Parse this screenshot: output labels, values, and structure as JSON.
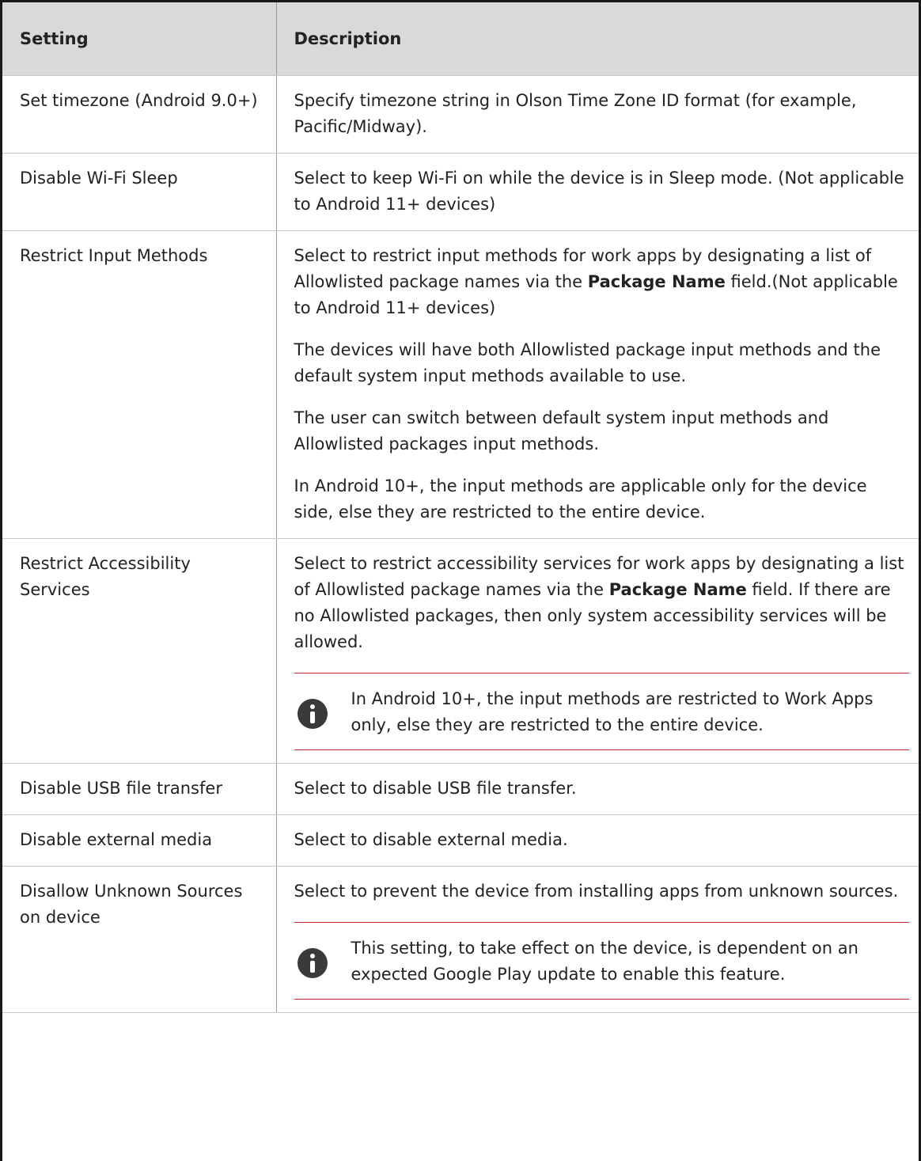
{
  "table": {
    "headers": [
      "Setting",
      "Description"
    ],
    "rows": [
      {
        "setting": "Set timezone (Android 9.0+)",
        "paragraphs": [
          [
            "Specify timezone string in Olson Time Zone ID format (for example, Pacific/Midway)."
          ]
        ]
      },
      {
        "setting": "Disable Wi-Fi Sleep",
        "paragraphs": [
          [
            "Select to keep Wi-Fi on while the device is in Sleep mode. (Not applicable to Android 11+ devices)"
          ]
        ]
      },
      {
        "setting": "Restrict Input Methods",
        "paragraphs": [
          [
            "Select to restrict input methods for work apps by designating a list of Allowlisted package names via the ",
            "Package Name",
            " field.(Not applicable to Android 11+ devices)"
          ],
          [
            "The devices will have both Allowlisted package input methods and the default system input methods available to use."
          ],
          [
            "The user can switch between default system input methods and Allowlisted packages input methods."
          ],
          [
            "In Android 10+, the input methods are applicable only for the device side, else they are restricted to the entire device."
          ]
        ]
      },
      {
        "setting": "Restrict Accessibility Services",
        "paragraphs": [
          [
            "Select to restrict accessibility services for work apps by designating a list of Allowlisted package names via the ",
            "Package Name",
            " field. If there are no Allowlisted packages, then only system accessibility services will be allowed."
          ]
        ],
        "note": "In Android 10+, the input methods are restricted to Work Apps only, else they are restricted to the entire device."
      },
      {
        "setting": "Disable USB file transfer",
        "paragraphs": [
          [
            "Select to disable USB file transfer."
          ]
        ]
      },
      {
        "setting": "Disable external media",
        "paragraphs": [
          [
            "Select to disable external media."
          ]
        ]
      },
      {
        "setting": "Disallow Unknown Sources on device",
        "paragraphs": [
          [
            "Select to prevent the device from installing apps from unknown sources."
          ]
        ],
        "note": "This setting, to take effect on the device, is dependent on an expected Google Play update to enable this feature."
      }
    ]
  },
  "note_icon": "info-icon"
}
